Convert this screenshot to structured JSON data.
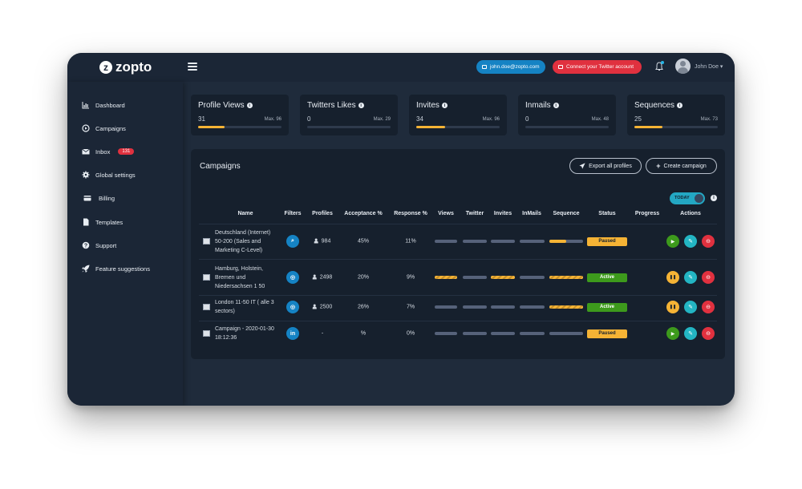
{
  "brand": {
    "name": "zopto",
    "mark": "z"
  },
  "header": {
    "email_button": "john.doe@zopto.com",
    "twitter_button": "Connect your Twitter account",
    "user_name": "John Doe ▾"
  },
  "sidebar": {
    "items": [
      {
        "label": "Dashboard",
        "icon": "bar-chart-icon"
      },
      {
        "label": "Campaigns",
        "icon": "play-circle-icon"
      },
      {
        "label": "Inbox",
        "icon": "envelope-icon",
        "badge": "131"
      },
      {
        "label": "Global settings",
        "icon": "gear-icon"
      },
      {
        "label": "Billing",
        "icon": "credit-card-icon"
      },
      {
        "label": "Templates",
        "icon": "file-icon"
      },
      {
        "label": "Support",
        "icon": "question-circle-icon"
      },
      {
        "label": "Feature suggestions",
        "icon": "rocket-icon"
      }
    ]
  },
  "stats": [
    {
      "title": "Profile Views",
      "value": "31",
      "max": "Max. 96",
      "ratio": 0.32
    },
    {
      "title": "Twitters Likes",
      "value": "0",
      "max": "Max. 29",
      "ratio": 0.0
    },
    {
      "title": "Invites",
      "value": "34",
      "max": "Max. 96",
      "ratio": 0.35
    },
    {
      "title": "Inmails",
      "value": "0",
      "max": "Max. 48",
      "ratio": 0.0
    },
    {
      "title": "Sequences",
      "value": "25",
      "max": "Max. 73",
      "ratio": 0.34
    }
  ],
  "campaigns": {
    "title": "Campaigns",
    "export_label": "Export all profiles",
    "create_label": "Create campaign",
    "toggle_label": "TODAY",
    "info": "i",
    "columns": [
      "Name",
      "Filters",
      "Profiles",
      "Acceptance %",
      "Response %",
      "Views",
      "Twitter",
      "Invites",
      "InMails",
      "Sequence",
      "Status",
      "Progress",
      "Actions"
    ],
    "rows": [
      {
        "name": "Deutschland (Internet) 50-200 (Sales and Marketing C-Level)",
        "filter": "search",
        "profiles": "984",
        "acceptance": "45%",
        "response": "11%",
        "views": 0.0,
        "twitter": 0.0,
        "invites": 0.0,
        "inmails": 0.0,
        "sequence": 0.5,
        "status": "Paused",
        "actions": [
          "play",
          "edit",
          "delete"
        ]
      },
      {
        "name": "Hamburg, Holstein, Bremen und Niedersachsen 1 50",
        "filter": "target",
        "profiles": "2498",
        "acceptance": "20%",
        "response": "9%",
        "views": 1.0,
        "twitter": 0.0,
        "invites": 1.0,
        "inmails": 0.0,
        "sequence": 1.0,
        "status": "Active",
        "actions": [
          "pause",
          "edit",
          "delete"
        ]
      },
      {
        "name": "London 11-50 IT ( alle 3 sectors)",
        "filter": "target",
        "profiles": "2500",
        "acceptance": "26%",
        "response": "7%",
        "views": 0.0,
        "twitter": 0.0,
        "invites": 0.0,
        "inmails": 0.0,
        "sequence": 1.0,
        "status": "Active",
        "actions": [
          "pause",
          "edit",
          "delete"
        ]
      },
      {
        "name": "Campaign - 2020-01-30 18:12:36",
        "filter": "in",
        "profiles": "-",
        "acceptance": "%",
        "response": "0%",
        "views": 0.0,
        "twitter": 0.0,
        "invites": 0.0,
        "inmails": 0.0,
        "sequence": 0.0,
        "status": "Paused",
        "actions": [
          "play",
          "edit",
          "delete"
        ]
      }
    ]
  },
  "colors": {
    "accent": "#f5b335",
    "active": "#3d9a1c",
    "danger": "#e0313f",
    "primary": "#1583c4",
    "teal": "#23b5c3"
  }
}
